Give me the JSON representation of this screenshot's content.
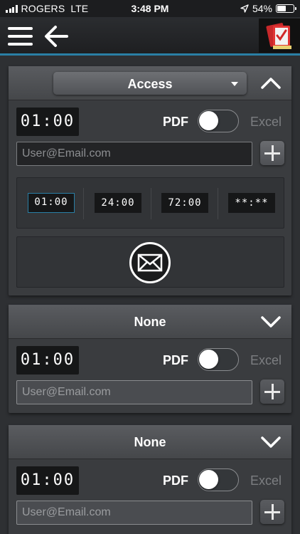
{
  "status_bar": {
    "carrier": "ROGERS",
    "network": "LTE",
    "time": "3:48 PM",
    "battery": "54%",
    "battery_level": 0.54
  },
  "nav": {
    "menu_icon": "hamburger-menu-icon",
    "back_icon": "back-arrow-icon",
    "logo_icon": "app-logo-icon"
  },
  "panels": [
    {
      "title": "Access",
      "expanded": true,
      "time": "01:00",
      "pdf_label": "PDF",
      "excel_label": "Excel",
      "email_placeholder": "User@Email.com",
      "presets": [
        "01:00",
        "24:00",
        "72:00",
        "**:**"
      ]
    },
    {
      "title": "None",
      "expanded": false,
      "time": "01:00",
      "pdf_label": "PDF",
      "excel_label": "Excel",
      "email_placeholder": "User@Email.com"
    },
    {
      "title": "None",
      "expanded": false,
      "time": "01:00",
      "pdf_label": "PDF",
      "excel_label": "Excel",
      "email_placeholder": "User@Email.com"
    }
  ],
  "colors": {
    "accent": "#2a7fa5",
    "background": "#2e3033",
    "panel": "#3a3c3f"
  }
}
